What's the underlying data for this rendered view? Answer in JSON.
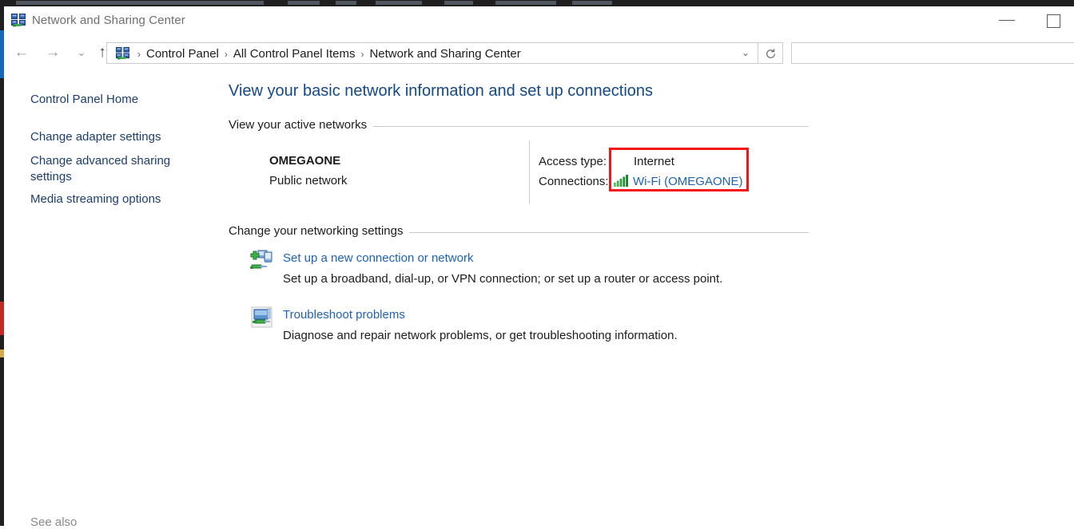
{
  "window": {
    "title": "Network and Sharing Center",
    "icon": "network-sharing-center-icon",
    "controls": {
      "minimize_label": "Minimize",
      "maximize_label": "Maximize"
    }
  },
  "navigation": {
    "back_label": "Back",
    "forward_label": "Forward",
    "recent_label": "Recent locations",
    "up_label": "Up one level",
    "back_glyph": "←",
    "forward_glyph": "→",
    "recent_glyph": "⌄",
    "up_glyph": "↑",
    "dropdown_glyph": "⌄",
    "refresh_label": "Refresh"
  },
  "address_bar": {
    "icon": "network-sharing-center-icon",
    "separator": "›",
    "crumbs": [
      {
        "label": "Control Panel"
      },
      {
        "label": "All Control Panel Items"
      },
      {
        "label": "Network and Sharing Center"
      }
    ]
  },
  "search": {
    "value": "",
    "placeholder": ""
  },
  "sidebar": {
    "items": [
      {
        "label": "Control Panel Home"
      },
      {
        "label": "Change adapter settings"
      },
      {
        "label": "Change advanced sharing settings"
      },
      {
        "label": "Media streaming options"
      }
    ],
    "see_also_label": "See also"
  },
  "main": {
    "heading": "View your basic network information and set up connections",
    "active_networks": {
      "section_label": "View your active networks",
      "network_name": "OMEGAONE",
      "network_type": "Public network",
      "access_type_label": "Access type:",
      "access_type_value": "Internet",
      "connections_label": "Connections:",
      "connection_icon": "wifi-signal-icon",
      "connection_link": "Wi-Fi (OMEGAONE)"
    },
    "networking_settings": {
      "section_label": "Change your networking settings",
      "items": [
        {
          "icon": "new-connection-icon",
          "link": "Set up a new connection or network",
          "description": "Set up a broadband, dial-up, or VPN connection; or set up a router or access point."
        },
        {
          "icon": "troubleshoot-icon",
          "link": "Troubleshoot problems",
          "description": "Diagnose and repair network problems, or get troubleshooting information."
        }
      ]
    }
  },
  "colors": {
    "heading_blue": "#13498b",
    "link_blue": "#1e62b5",
    "nav_link_blue": "#1c3e6e",
    "highlight_red": "#f41616",
    "wifi_green": "#2f9e44"
  }
}
